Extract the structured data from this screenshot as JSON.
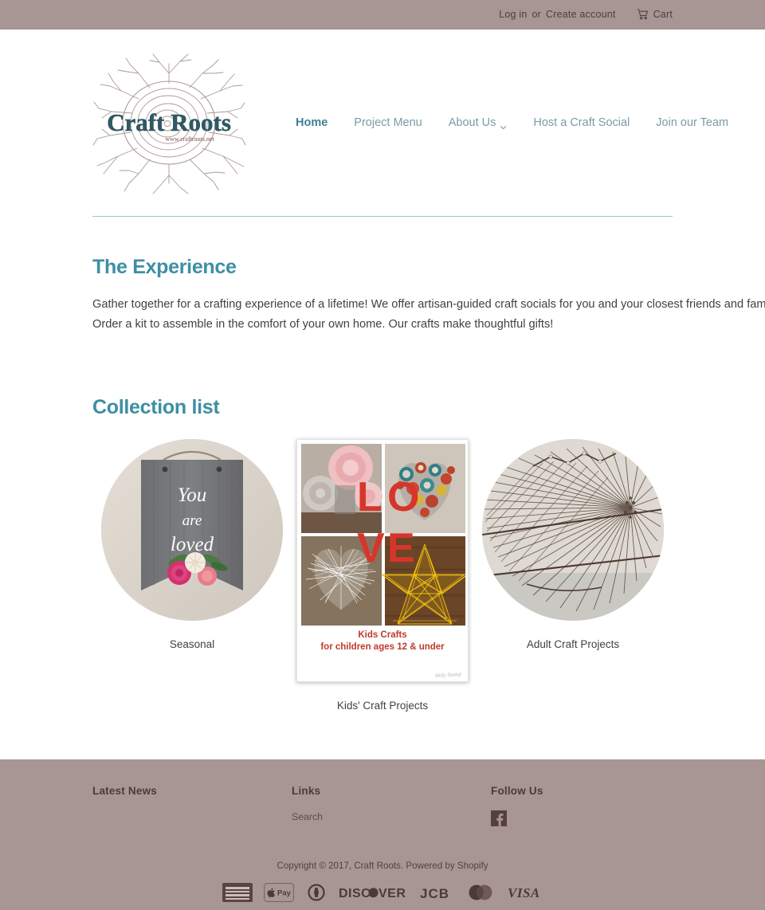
{
  "topbar": {
    "login": "Log in",
    "or": "or",
    "create_account": "Create account",
    "cart": "Cart",
    "cart_icon": "shopping-cart-icon"
  },
  "logo": {
    "brand": "Craft Roots",
    "url_text": "www.craftroots.net",
    "icon": "tree-with-roots-logo"
  },
  "nav": {
    "items": [
      {
        "label": "Home",
        "active": true
      },
      {
        "label": "Project Menu",
        "active": false
      },
      {
        "label": "About Us",
        "active": false,
        "caret": "chevron-down-icon"
      },
      {
        "label": "Host a Craft Social",
        "active": false
      },
      {
        "label": "Join our Team",
        "active": false
      }
    ]
  },
  "experience": {
    "heading": "The Experience",
    "body": "Gather together for a crafting experience of a lifetime!  We offer artisan-guided craft socials for you and your closest friends and family. Aren't the hosting type?  Order a kit to assemble in the comfort of your own home.   Our crafts make thoughtful gifts!"
  },
  "collection": {
    "heading": "Collection list",
    "items": [
      {
        "label": "Seasonal",
        "image": "wood-sign-you-are-loved"
      },
      {
        "label": "Kids' Craft Projects",
        "image": "kids-crafts-flyer"
      },
      {
        "label": "Adult Craft Projects",
        "image": "string-art-closeup"
      }
    ],
    "flyer": {
      "line1": "Kids Crafts",
      "line2": "for children ages 12 & under",
      "overlay_text": "LOVE",
      "signature": "Holy Stamp"
    },
    "sign_text": {
      "line1": "You",
      "line2": "are",
      "line3": "loved"
    }
  },
  "footer": {
    "columns": [
      {
        "heading": "Latest News",
        "links": []
      },
      {
        "heading": "Links",
        "links": [
          "Search"
        ]
      },
      {
        "heading": "Follow Us",
        "links": []
      }
    ],
    "facebook_icon": "facebook-icon",
    "copyright": "Copyright © 2017, Craft Roots. Powered by Shopify",
    "payments": [
      "American Express",
      "Apple Pay",
      "Diners Club",
      "Discover",
      "JCB",
      "Mastercard",
      "Visa"
    ]
  },
  "colors": {
    "bar": "#a79694",
    "accent_teal": "#3d8fa3",
    "nav_link": "#7a9ba5",
    "flyer_red": "#c0392b",
    "footer_text": "#4a3b39"
  }
}
